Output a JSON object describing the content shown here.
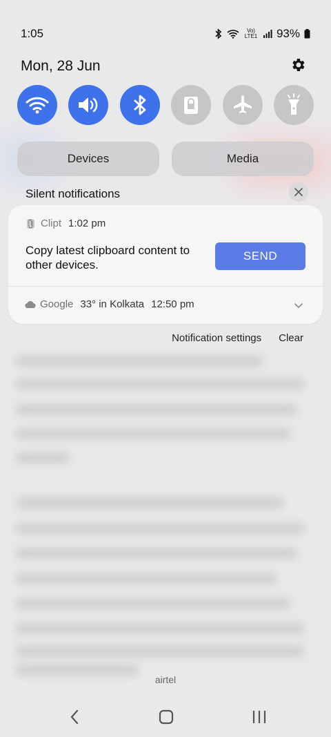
{
  "status_bar": {
    "time": "1:05",
    "network_label": "Vo) LTE1",
    "battery": "93%"
  },
  "header": {
    "date": "Mon, 28 Jun"
  },
  "quick_settings": [
    {
      "name": "wifi",
      "on": true
    },
    {
      "name": "sound",
      "on": true
    },
    {
      "name": "bluetooth",
      "on": true
    },
    {
      "name": "lock",
      "on": false
    },
    {
      "name": "airplane",
      "on": false
    },
    {
      "name": "flashlight",
      "on": false
    }
  ],
  "panels": {
    "devices_label": "Devices",
    "media_label": "Media"
  },
  "notifications": {
    "section_title": "Silent notifications",
    "clipt": {
      "app": "Clipt",
      "time": "1:02 pm",
      "body": "Copy latest clipboard content to other devices.",
      "action": "SEND"
    },
    "google": {
      "app": "Google",
      "summary": "33° in Kolkata",
      "time": "12:50 pm"
    },
    "settings_label": "Notification settings",
    "clear_label": "Clear"
  },
  "carrier": "airtel",
  "colors": {
    "accent": "#3e72ea",
    "send_button": "#5a7ae8",
    "tile_off": "#c6c6c8"
  }
}
